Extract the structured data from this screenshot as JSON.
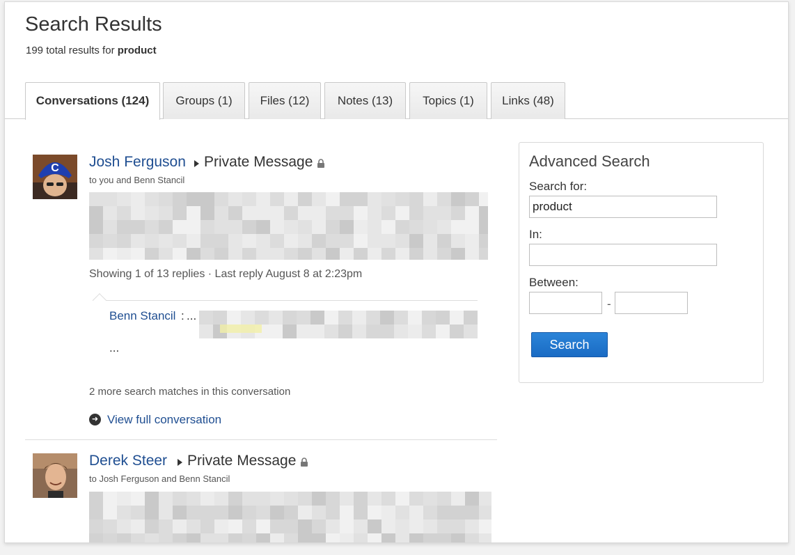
{
  "page": {
    "title": "Search Results",
    "summary_prefix": "199 total results for",
    "query": "product"
  },
  "tabs": [
    {
      "label": "Conversations (124)",
      "active": true
    },
    {
      "label": "Groups (1)"
    },
    {
      "label": "Files (12)"
    },
    {
      "label": "Notes (13)"
    },
    {
      "label": "Topics (1)"
    },
    {
      "label": "Links (48)"
    }
  ],
  "results": [
    {
      "sender": "Josh Ferguson",
      "type": "Private Message",
      "recipients": "to you and Benn Stancil",
      "reply_meta": "Showing 1 of 13 replies · Last reply August 8 at 2:23pm",
      "reply_author": "Benn Stancil",
      "reply_colon": ":",
      "reply_ellipsis": "...",
      "more_matches": "2 more search matches in this conversation",
      "view_full": "View full conversation"
    },
    {
      "sender": "Derek Steer",
      "type": "Private Message",
      "recipients": "to Josh Ferguson and Benn Stancil"
    }
  ],
  "advanced_search": {
    "title": "Advanced Search",
    "search_for_label": "Search for:",
    "search_for_value": "product",
    "in_label": "In:",
    "in_value": "",
    "between_label": "Between:",
    "between_from": "",
    "between_to": "",
    "dash": "-",
    "button_label": "Search"
  },
  "colors": {
    "link": "#1f4e91",
    "button": "#1a6bc4"
  }
}
